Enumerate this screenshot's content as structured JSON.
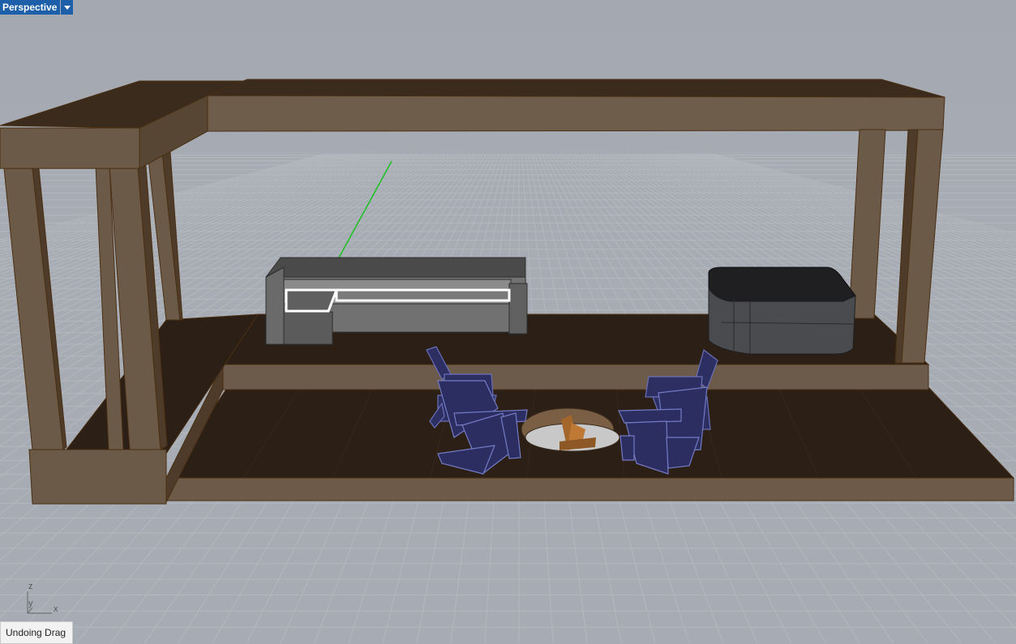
{
  "viewport": {
    "name": "Perspective",
    "status_message": "Undoing Drag",
    "axis_labels": {
      "z": "z",
      "y": "y",
      "x": "x"
    }
  },
  "colors": {
    "background": "#a6abb3",
    "grid_line": "#b5b9c0",
    "wood_light": "#6e5c4b",
    "wood_dark": "#3a2a1c",
    "floor": "#2b1f16",
    "sofa": "#6a6a6a",
    "tub": "#3b3c3f",
    "chairs": "#2a2c5a",
    "selection": "#ffffff",
    "y_axis": "#19c21f"
  }
}
